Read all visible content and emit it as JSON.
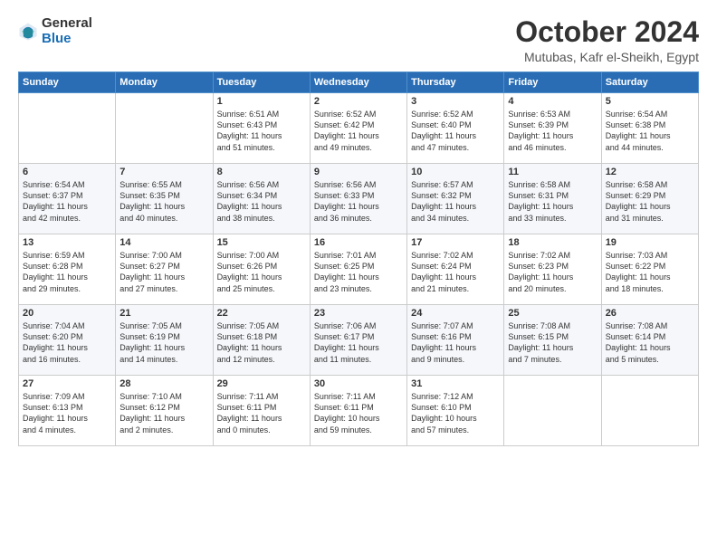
{
  "header": {
    "logo_line1": "General",
    "logo_line2": "Blue",
    "month": "October 2024",
    "location": "Mutubas, Kafr el-Sheikh, Egypt"
  },
  "weekdays": [
    "Sunday",
    "Monday",
    "Tuesday",
    "Wednesday",
    "Thursday",
    "Friday",
    "Saturday"
  ],
  "weeks": [
    [
      {
        "day": "",
        "content": ""
      },
      {
        "day": "",
        "content": ""
      },
      {
        "day": "1",
        "content": "Sunrise: 6:51 AM\nSunset: 6:43 PM\nDaylight: 11 hours\nand 51 minutes."
      },
      {
        "day": "2",
        "content": "Sunrise: 6:52 AM\nSunset: 6:42 PM\nDaylight: 11 hours\nand 49 minutes."
      },
      {
        "day": "3",
        "content": "Sunrise: 6:52 AM\nSunset: 6:40 PM\nDaylight: 11 hours\nand 47 minutes."
      },
      {
        "day": "4",
        "content": "Sunrise: 6:53 AM\nSunset: 6:39 PM\nDaylight: 11 hours\nand 46 minutes."
      },
      {
        "day": "5",
        "content": "Sunrise: 6:54 AM\nSunset: 6:38 PM\nDaylight: 11 hours\nand 44 minutes."
      }
    ],
    [
      {
        "day": "6",
        "content": "Sunrise: 6:54 AM\nSunset: 6:37 PM\nDaylight: 11 hours\nand 42 minutes."
      },
      {
        "day": "7",
        "content": "Sunrise: 6:55 AM\nSunset: 6:35 PM\nDaylight: 11 hours\nand 40 minutes."
      },
      {
        "day": "8",
        "content": "Sunrise: 6:56 AM\nSunset: 6:34 PM\nDaylight: 11 hours\nand 38 minutes."
      },
      {
        "day": "9",
        "content": "Sunrise: 6:56 AM\nSunset: 6:33 PM\nDaylight: 11 hours\nand 36 minutes."
      },
      {
        "day": "10",
        "content": "Sunrise: 6:57 AM\nSunset: 6:32 PM\nDaylight: 11 hours\nand 34 minutes."
      },
      {
        "day": "11",
        "content": "Sunrise: 6:58 AM\nSunset: 6:31 PM\nDaylight: 11 hours\nand 33 minutes."
      },
      {
        "day": "12",
        "content": "Sunrise: 6:58 AM\nSunset: 6:29 PM\nDaylight: 11 hours\nand 31 minutes."
      }
    ],
    [
      {
        "day": "13",
        "content": "Sunrise: 6:59 AM\nSunset: 6:28 PM\nDaylight: 11 hours\nand 29 minutes."
      },
      {
        "day": "14",
        "content": "Sunrise: 7:00 AM\nSunset: 6:27 PM\nDaylight: 11 hours\nand 27 minutes."
      },
      {
        "day": "15",
        "content": "Sunrise: 7:00 AM\nSunset: 6:26 PM\nDaylight: 11 hours\nand 25 minutes."
      },
      {
        "day": "16",
        "content": "Sunrise: 7:01 AM\nSunset: 6:25 PM\nDaylight: 11 hours\nand 23 minutes."
      },
      {
        "day": "17",
        "content": "Sunrise: 7:02 AM\nSunset: 6:24 PM\nDaylight: 11 hours\nand 21 minutes."
      },
      {
        "day": "18",
        "content": "Sunrise: 7:02 AM\nSunset: 6:23 PM\nDaylight: 11 hours\nand 20 minutes."
      },
      {
        "day": "19",
        "content": "Sunrise: 7:03 AM\nSunset: 6:22 PM\nDaylight: 11 hours\nand 18 minutes."
      }
    ],
    [
      {
        "day": "20",
        "content": "Sunrise: 7:04 AM\nSunset: 6:20 PM\nDaylight: 11 hours\nand 16 minutes."
      },
      {
        "day": "21",
        "content": "Sunrise: 7:05 AM\nSunset: 6:19 PM\nDaylight: 11 hours\nand 14 minutes."
      },
      {
        "day": "22",
        "content": "Sunrise: 7:05 AM\nSunset: 6:18 PM\nDaylight: 11 hours\nand 12 minutes."
      },
      {
        "day": "23",
        "content": "Sunrise: 7:06 AM\nSunset: 6:17 PM\nDaylight: 11 hours\nand 11 minutes."
      },
      {
        "day": "24",
        "content": "Sunrise: 7:07 AM\nSunset: 6:16 PM\nDaylight: 11 hours\nand 9 minutes."
      },
      {
        "day": "25",
        "content": "Sunrise: 7:08 AM\nSunset: 6:15 PM\nDaylight: 11 hours\nand 7 minutes."
      },
      {
        "day": "26",
        "content": "Sunrise: 7:08 AM\nSunset: 6:14 PM\nDaylight: 11 hours\nand 5 minutes."
      }
    ],
    [
      {
        "day": "27",
        "content": "Sunrise: 7:09 AM\nSunset: 6:13 PM\nDaylight: 11 hours\nand 4 minutes."
      },
      {
        "day": "28",
        "content": "Sunrise: 7:10 AM\nSunset: 6:12 PM\nDaylight: 11 hours\nand 2 minutes."
      },
      {
        "day": "29",
        "content": "Sunrise: 7:11 AM\nSunset: 6:11 PM\nDaylight: 11 hours\nand 0 minutes."
      },
      {
        "day": "30",
        "content": "Sunrise: 7:11 AM\nSunset: 6:11 PM\nDaylight: 10 hours\nand 59 minutes."
      },
      {
        "day": "31",
        "content": "Sunrise: 7:12 AM\nSunset: 6:10 PM\nDaylight: 10 hours\nand 57 minutes."
      },
      {
        "day": "",
        "content": ""
      },
      {
        "day": "",
        "content": ""
      }
    ]
  ]
}
